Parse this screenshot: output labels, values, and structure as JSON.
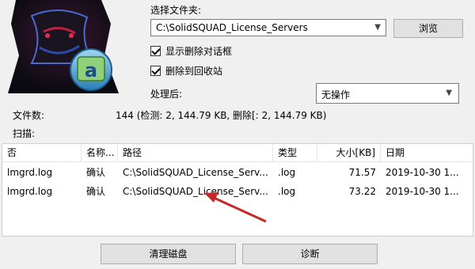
{
  "folder": {
    "label": "选择文件夹:",
    "value": "C:\\SolidSQUAD_License_Servers",
    "browse_label": "浏览"
  },
  "options": {
    "show_delete_dialog": {
      "label": "显示删除对话框",
      "checked": true
    },
    "delete_to_recycle": {
      "label": "删除到回收站",
      "checked": true
    },
    "after_label": "处理后:",
    "after_value": "无操作"
  },
  "stats": {
    "file_count_label": "文件数:",
    "file_count_value": "144 (检测: 2, 144.79 KB, 删除[: 2, 144.79 KB)",
    "scan_label": "扫描:"
  },
  "table": {
    "columns": [
      "否",
      "名称...",
      "路径",
      "类型",
      "大小[KB]",
      "日期"
    ],
    "rows": [
      [
        "lmgrd.log",
        "确认",
        "C:\\SolidSQUAD_License_Serv...",
        ".log",
        "71.57",
        "2019-10-30 1..."
      ],
      [
        "lmgrd.log",
        "确认",
        "C:\\SolidSQUAD_License_Serv...",
        ".log",
        "73.22",
        "2019-10-30 1..."
      ]
    ]
  },
  "buttons": {
    "clean": "清理磁盘",
    "diagnose": "诊断"
  },
  "colors": {
    "annotation_arrow": "#c62828"
  }
}
